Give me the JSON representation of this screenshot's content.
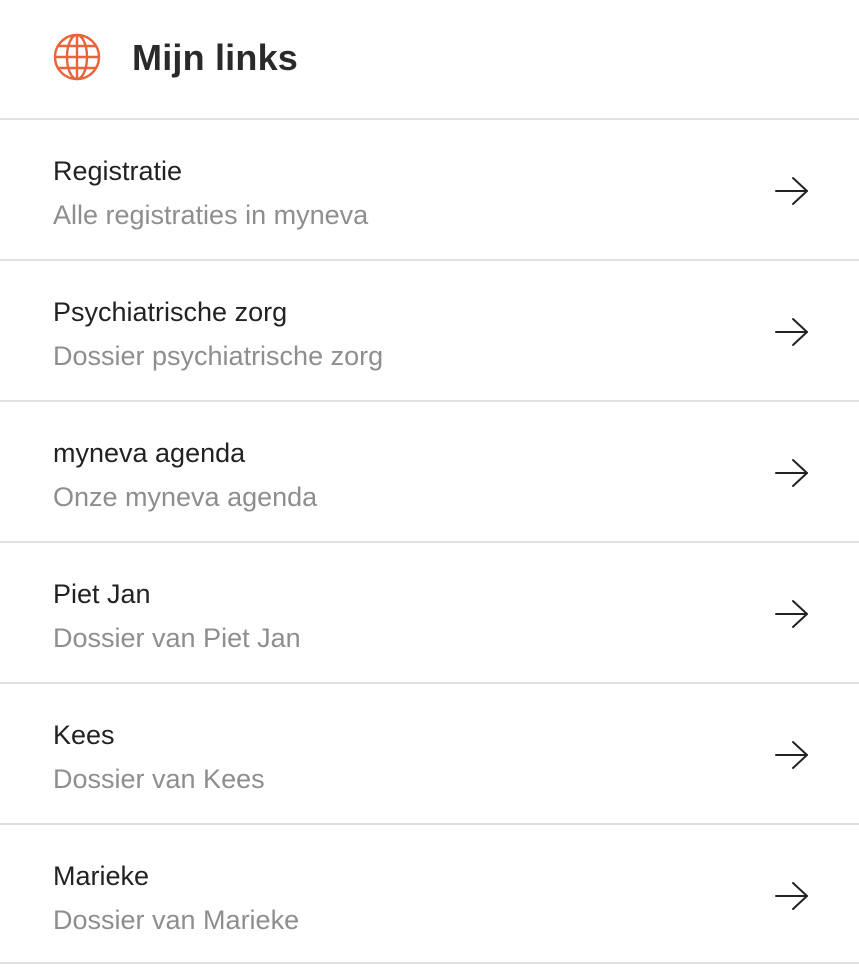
{
  "header": {
    "icon": "globe-icon",
    "title": "Mijn links",
    "accent_color": "#e8643a"
  },
  "links": [
    {
      "title": "Registratie",
      "subtitle": "Alle registraties in myneva",
      "icon": "arrow-right-icon"
    },
    {
      "title": "Psychiatrische zorg",
      "subtitle": "Dossier psychiatrische zorg",
      "icon": "arrow-right-icon"
    },
    {
      "title": "myneva agenda",
      "subtitle": "Onze myneva agenda",
      "icon": "arrow-right-icon"
    },
    {
      "title": "Piet Jan",
      "subtitle": "Dossier van Piet Jan",
      "icon": "arrow-right-icon"
    },
    {
      "title": "Kees",
      "subtitle": "Dossier van Kees",
      "icon": "arrow-right-icon"
    },
    {
      "title": "Marieke",
      "subtitle": "Dossier van Marieke",
      "icon": "arrow-right-icon"
    }
  ]
}
